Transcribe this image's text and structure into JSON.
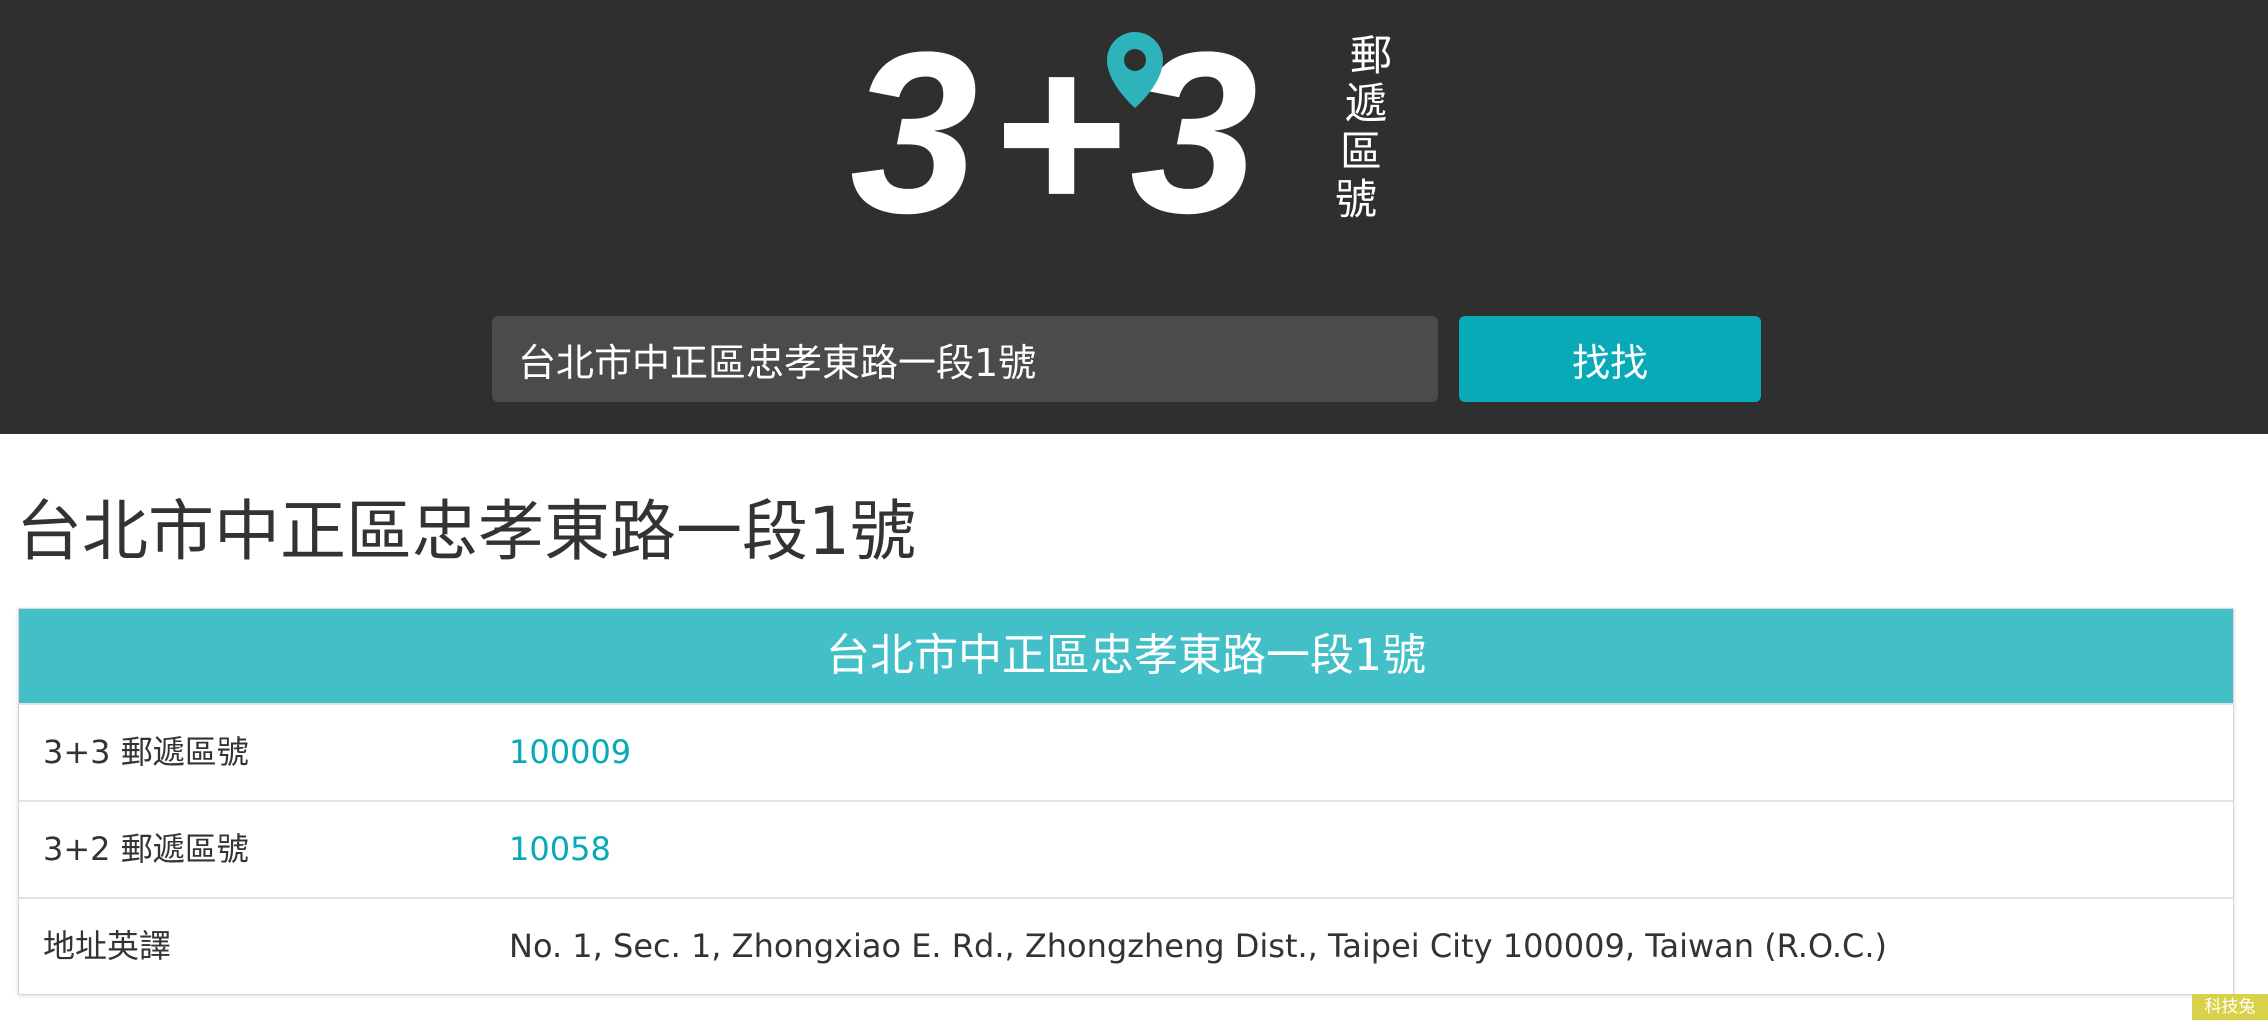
{
  "header": {
    "logo": {
      "number_left": "3",
      "plus": "+",
      "number_right": "3",
      "tagline": [
        "郵",
        "遞",
        "區",
        "號"
      ],
      "pin_color": "#2eb3bb"
    },
    "search": {
      "value": "台北市中正區忠孝東路一段1號",
      "button_label": "找找"
    }
  },
  "main": {
    "page_title": "台北市中正區忠孝東路一段1號",
    "card": {
      "title": "台北市中正區忠孝東路一段1號",
      "rows": [
        {
          "label": "3+3 郵遞區號",
          "value": "100009"
        },
        {
          "label": "3+2 郵遞區號",
          "value": "10058"
        },
        {
          "label": "地址英譯",
          "value": "No. 1, Sec. 1, Zhongxiao E. Rd., Zhongzheng Dist., Taipei City 100009, Taiwan (R.O.C.)"
        }
      ]
    }
  },
  "watermark": "科技兔",
  "colors": {
    "header_bg": "#2f2f2f",
    "accent": "#07aab6",
    "card_header": "#43c0c7"
  }
}
